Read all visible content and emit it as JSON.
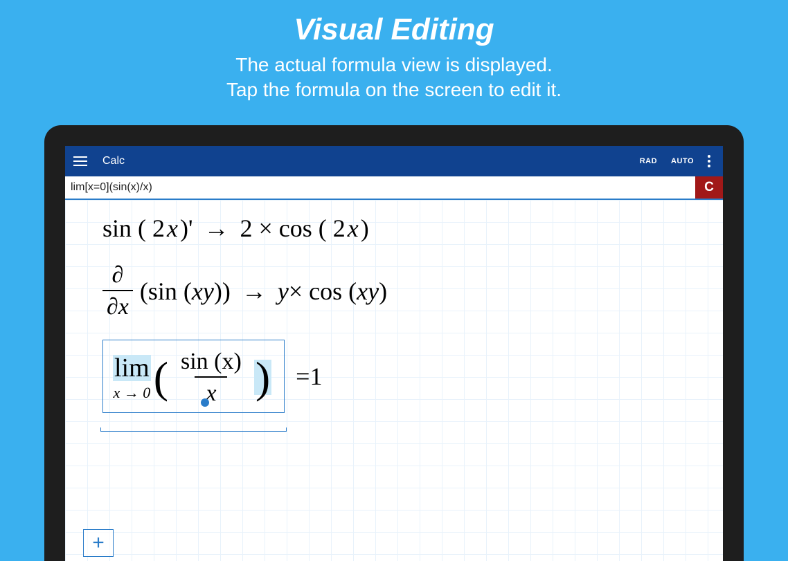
{
  "promo": {
    "title": "Visual Editing",
    "subtitle_line1": "The actual formula view is displayed.",
    "subtitle_line2": "Tap the formula on the screen to edit it."
  },
  "app": {
    "title": "Calc",
    "angle_mode": "RAD",
    "auto_mode": "AUTO",
    "input_value": "lim[x=0](sin(x)/x)",
    "clear_label": "C"
  },
  "equations": {
    "eq1_left": "sin ( 2",
    "eq1_left_var": "x",
    "eq1_left_end": ")'",
    "eq1_right": "2 × cos ( 2",
    "eq1_right_var": "x",
    "eq1_right_end": ")",
    "eq2_partial_num": "∂",
    "eq2_partial_den": "∂x",
    "eq2_body": "(sin (",
    "eq2_body_var": "xy",
    "eq2_body_end": "))",
    "eq2_right": "y",
    "eq2_right_op": " × cos ( ",
    "eq2_right_var": "xy",
    "eq2_right_end": ")",
    "eq3_lim": "lim",
    "eq3_sub": "x → 0",
    "eq3_num": "sin (x)",
    "eq3_den": "x",
    "eq3_eq": " = ",
    "eq3_result": "1",
    "arrow": "→",
    "add_label": "+"
  }
}
